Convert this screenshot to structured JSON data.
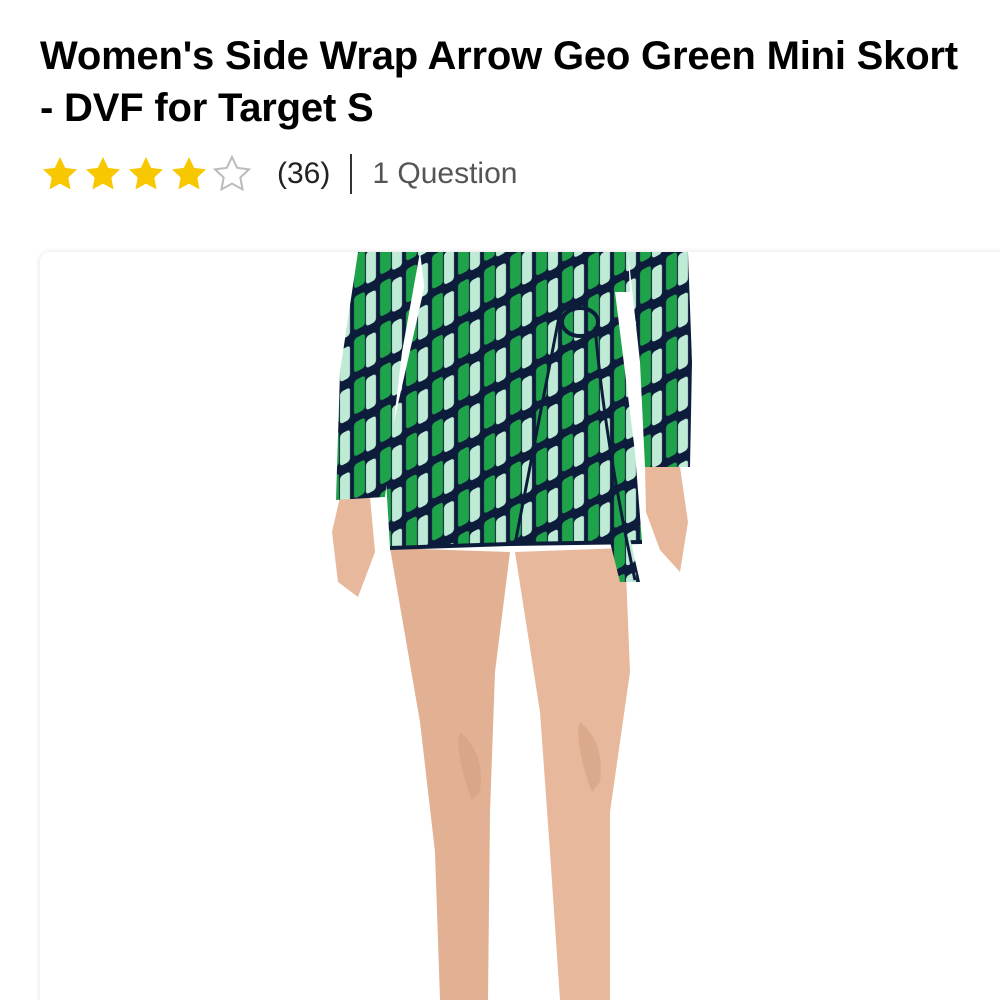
{
  "product": {
    "title": "Women's Side Wrap Arrow Geo Green Mini Skort - DVF for Target S",
    "rating": {
      "value": 4,
      "max": 5,
      "review_count_label": "(36)",
      "star_color": "#F7C700",
      "empty_star_color": "#BBBBBB"
    },
    "questions_label": "1 Question",
    "image": {
      "colors": {
        "print_green": "#1FA34A",
        "print_navy": "#0C1C3A",
        "print_mint": "#BFEBD6",
        "skin": "#E7B89B"
      }
    }
  }
}
